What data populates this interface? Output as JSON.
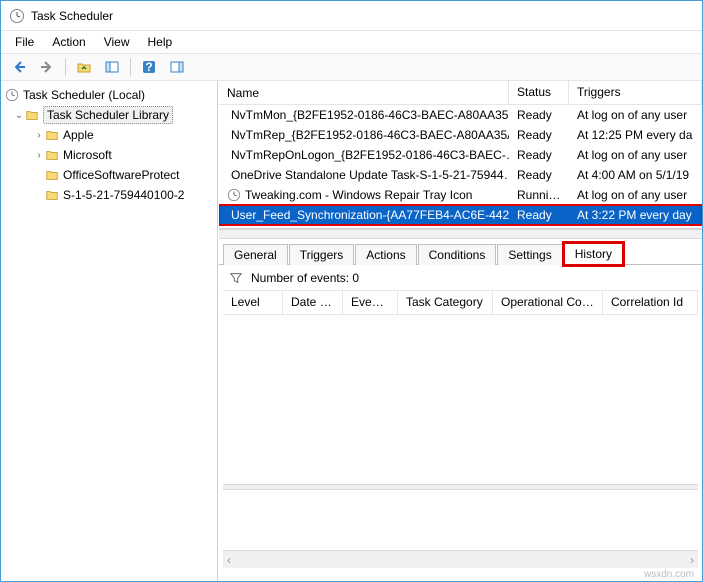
{
  "window": {
    "title": "Task Scheduler"
  },
  "menu": {
    "file": "File",
    "action": "Action",
    "view": "View",
    "help": "Help"
  },
  "tree": {
    "root": "Task Scheduler (Local)",
    "lib": "Task Scheduler Library",
    "items": [
      "Apple",
      "Microsoft",
      "OfficeSoftwareProtect",
      "S-1-5-21-759440100-2"
    ]
  },
  "columns": {
    "name": "Name",
    "status": "Status",
    "triggers": "Triggers"
  },
  "tasks": [
    {
      "name": "NvTmMon_{B2FE1952-0186-46C3-BAEC-A80AA35…",
      "status": "Ready",
      "trigger": "At log on of any user"
    },
    {
      "name": "NvTmRep_{B2FE1952-0186-46C3-BAEC-A80AA35A…",
      "status": "Ready",
      "trigger": "At 12:25 PM every da"
    },
    {
      "name": "NvTmRepOnLogon_{B2FE1952-0186-46C3-BAEC-…",
      "status": "Ready",
      "trigger": "At log on of any user"
    },
    {
      "name": "OneDrive Standalone Update Task-S-1-5-21-75944…",
      "status": "Ready",
      "trigger": "At 4:00 AM on 5/1/19"
    },
    {
      "name": "Tweaking.com - Windows Repair Tray Icon",
      "status": "Running",
      "trigger": "At log on of any user"
    },
    {
      "name": "User_Feed_Synchronization-{AA77FEB4-AC6E-442…",
      "status": "Ready",
      "trigger": "At 3:22 PM every day"
    }
  ],
  "tabs": {
    "general": "General",
    "triggers": "Triggers",
    "actions": "Actions",
    "conditions": "Conditions",
    "settings": "Settings",
    "history": "History"
  },
  "history": {
    "events_label": "Number of events: 0",
    "cols": {
      "level": "Level",
      "date": "Date a…",
      "event": "Event…",
      "taskcat": "Task Category",
      "opcode": "Operational Code",
      "corr": "Correlation Id"
    }
  },
  "watermark": "wsxdn.com"
}
